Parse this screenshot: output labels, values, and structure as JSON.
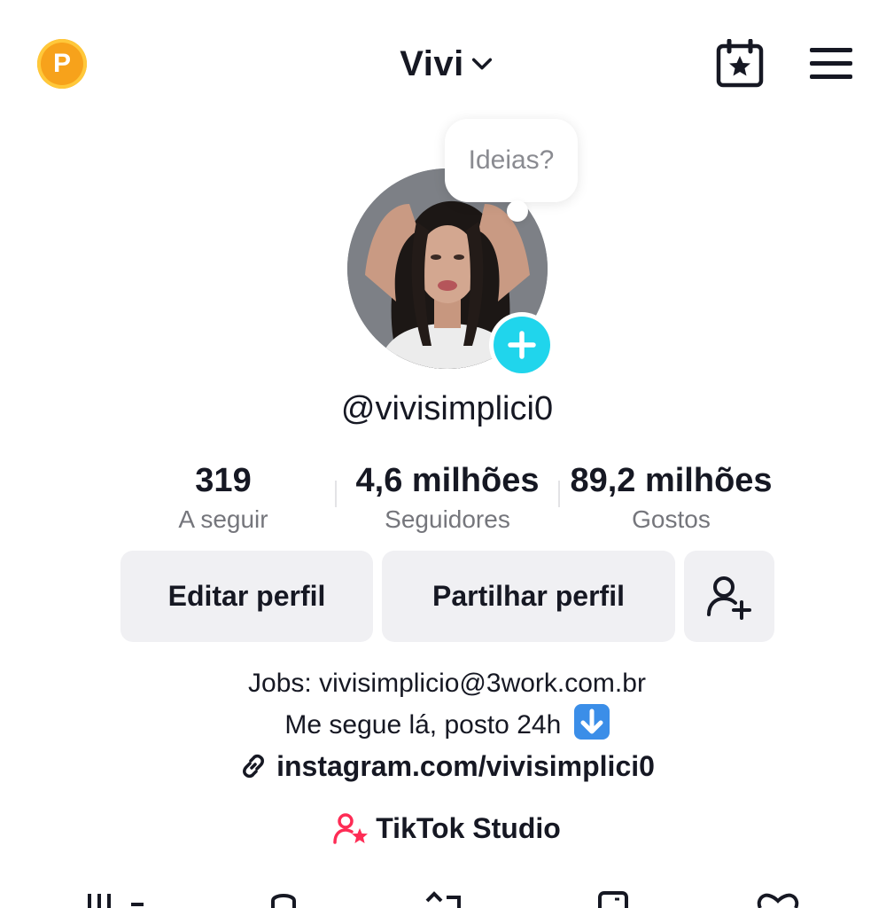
{
  "header": {
    "coin_label": "P",
    "account_name": "Vivi",
    "icons": [
      "coin-p-icon",
      "chevron-down-icon",
      "calendar-star-icon",
      "hamburger-menu-icon"
    ]
  },
  "profile": {
    "bubble_text": "Ideias?",
    "handle": "@vivisimplici0"
  },
  "stats": [
    {
      "value": "319",
      "label": "A seguir"
    },
    {
      "value": "4,6 milhões",
      "label": "Seguidores"
    },
    {
      "value": "89,2 milhões",
      "label": "Gostos"
    }
  ],
  "actions": {
    "edit": "Editar perfil",
    "share": "Partilhar perfil",
    "add_friend_icon": "add-user-icon"
  },
  "bio": {
    "line1": "Jobs:  vivisimplicio@3work.com.br",
    "line2": "Me segue lá, posto 24h",
    "link": "instagram.com/vivisimplici0",
    "studio": "TikTok Studio"
  },
  "tabs": [
    "grid-icon",
    "lock-icon",
    "repost-icon",
    "bookmark-icon",
    "heart-icon"
  ],
  "colors": {
    "accent_cyan": "#20d5ec",
    "coin_orange": "#f7a21b",
    "studio_pink": "#fe2c55",
    "button_bg": "#f0f0f3"
  }
}
